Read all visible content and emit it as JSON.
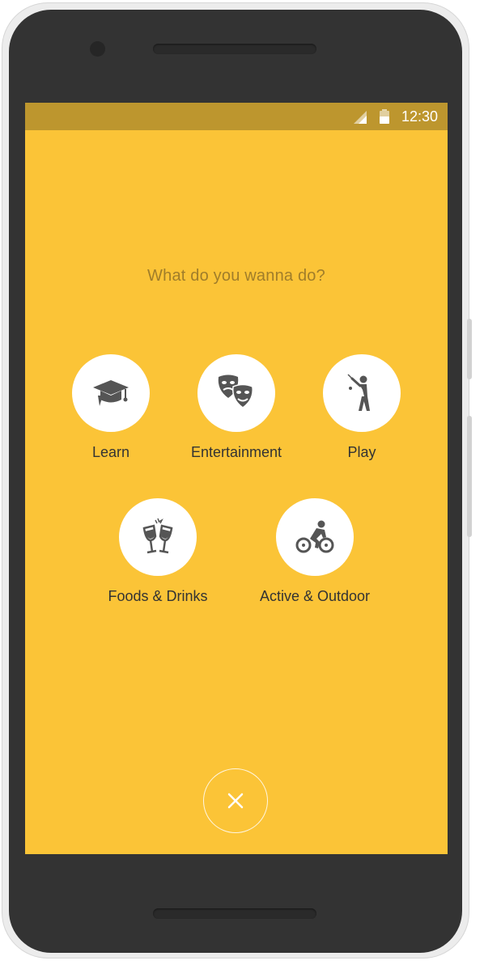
{
  "status_bar": {
    "time": "12:30",
    "signal_icon": "signal-icon",
    "battery_icon": "battery-icon"
  },
  "prompt": "What do you wanna do?",
  "options": [
    {
      "label": "Learn",
      "icon": "graduation-cap-icon"
    },
    {
      "label": "Entertainment",
      "icon": "theater-masks-icon"
    },
    {
      "label": "Play",
      "icon": "golf-player-icon"
    },
    {
      "label": "Foods & Drinks",
      "icon": "champagne-glasses-icon"
    },
    {
      "label": "Active & Outdoor",
      "icon": "cyclist-icon"
    }
  ],
  "close_button": {
    "icon": "close-icon"
  },
  "colors": {
    "screen_background": "#fbc437",
    "status_bar": "#bd962e",
    "prompt_text": "#a07d2a",
    "icon": "#555555",
    "phone_body": "#333333"
  }
}
